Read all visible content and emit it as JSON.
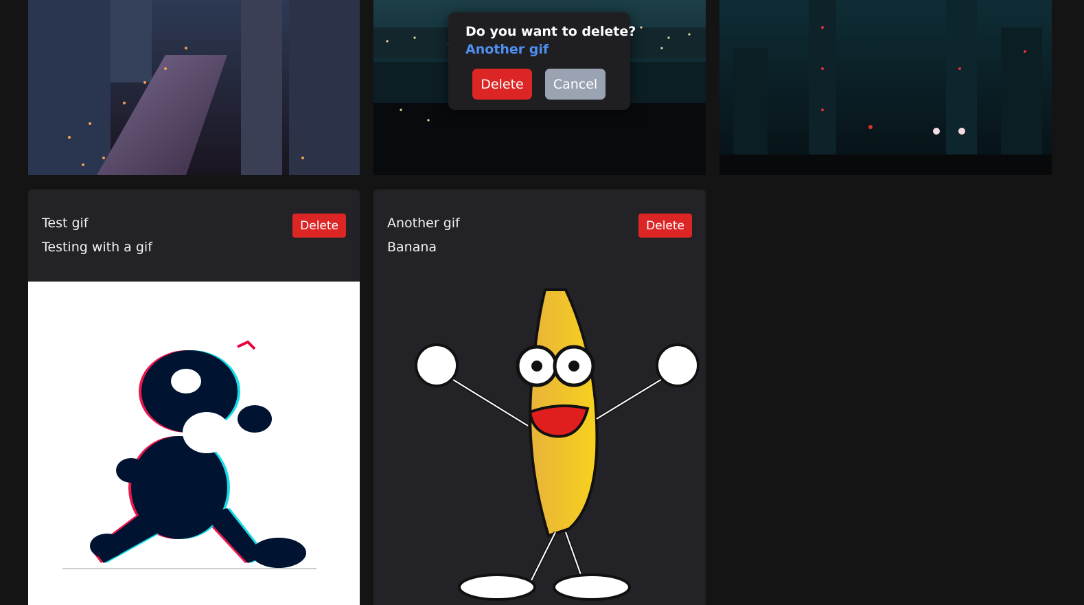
{
  "gallery": {
    "photos": [
      {
        "name": "city-river-night-photo"
      },
      {
        "name": "city-harbor-night-photo"
      },
      {
        "name": "city-tower-night-photo"
      }
    ]
  },
  "cards": [
    {
      "title": "Test gif",
      "description": "Testing with a gif",
      "delete_label": "Delete",
      "media": "glitch-cartoon-cat-gif"
    },
    {
      "title": "Another gif",
      "description": "Banana",
      "delete_label": "Delete",
      "media": "dancing-banana-gif"
    }
  ],
  "confirm_dialog": {
    "question": "Do you want to delete?",
    "item_name": "Another gif",
    "delete_label": "Delete",
    "cancel_label": "Cancel"
  },
  "colors": {
    "background": "#141414",
    "card": "#232327",
    "danger": "#dc2626",
    "cancel": "#9aa3b2",
    "link_accent": "#4f8ff0"
  }
}
